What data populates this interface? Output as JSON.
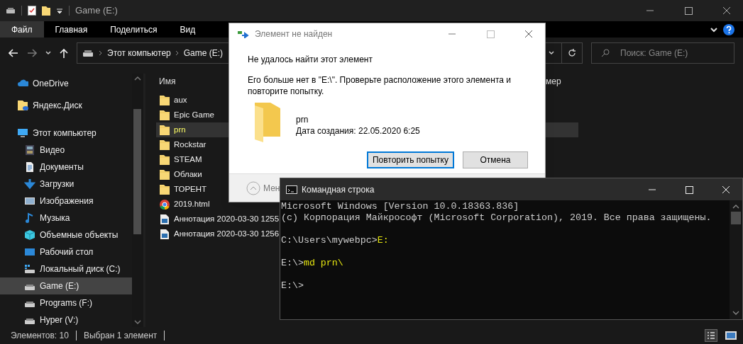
{
  "explorer": {
    "title": "Game (E:)",
    "ribbon_tabs": [
      {
        "label": "Файл",
        "selected": true
      },
      {
        "label": "Главная",
        "selected": false
      },
      {
        "label": "Поделиться",
        "selected": false
      },
      {
        "label": "Вид",
        "selected": false
      }
    ],
    "breadcrumb": [
      "Этот компьютер",
      "Game (E:)"
    ],
    "search": {
      "placeholder": "Поиск: Game (E:)"
    },
    "sidebar": {
      "items": [
        {
          "label": "OneDrive",
          "kind": "cloud",
          "selected": false
        },
        {
          "label": "Яндекс.Диск",
          "kind": "yadisk",
          "selected": false
        },
        {
          "label": "Этот компьютер",
          "kind": "pc",
          "selected": false,
          "children": [
            {
              "label": "Видео",
              "kind": "video",
              "selected": false
            },
            {
              "label": "Документы",
              "kind": "doc",
              "selected": false
            },
            {
              "label": "Загрузки",
              "kind": "download",
              "selected": false
            },
            {
              "label": "Изображения",
              "kind": "image",
              "selected": false
            },
            {
              "label": "Музыка",
              "kind": "music",
              "selected": false
            },
            {
              "label": "Объемные объекты",
              "kind": "cube",
              "selected": false
            },
            {
              "label": "Рабочий стол",
              "kind": "desktop",
              "selected": false
            },
            {
              "label": "Локальный диск (C:)",
              "kind": "sysdrive",
              "selected": false
            },
            {
              "label": "Game (E:)",
              "kind": "drive",
              "selected": true
            },
            {
              "label": "Programs (F:)",
              "kind": "drive",
              "selected": false
            },
            {
              "label": "Hyper (V:)",
              "kind": "drive",
              "selected": false
            }
          ]
        }
      ]
    },
    "columns": [
      "Имя",
      "мер"
    ],
    "files": [
      {
        "name": "aux",
        "kind": "folder",
        "selected": false
      },
      {
        "name": "Epic Game",
        "kind": "folder",
        "selected": false
      },
      {
        "name": "prn",
        "kind": "folder",
        "selected": true
      },
      {
        "name": "Rockstar",
        "kind": "folder",
        "selected": false
      },
      {
        "name": "STEAM",
        "kind": "folder",
        "selected": false
      },
      {
        "name": "Облаки",
        "kind": "folder",
        "selected": false
      },
      {
        "name": "ТОРЕНТ",
        "kind": "folder",
        "selected": false
      },
      {
        "name": "2019.html",
        "kind": "browser",
        "selected": false
      },
      {
        "name": "Аннотация 2020-03-30 1255",
        "kind": "image",
        "selected": false
      },
      {
        "name": "Аннотация 2020-03-30 1256",
        "kind": "image",
        "selected": false
      }
    ],
    "status_bar": [
      "Элементов: 10",
      "Выбран 1 элемент"
    ]
  },
  "dialog": {
    "title": "Элемент не найден",
    "heading": "Не удалось найти этот элемент",
    "message": "Его больше нет в \"E:\\\". Проверьте расположение этого элемента и повторите попытку.",
    "item_name": "prn",
    "item_date": "Дата создания: 22.05.2020 6:25",
    "buttons": [
      "Повторить попытку",
      "Отмена"
    ],
    "details_toggle": "Мен"
  },
  "console": {
    "title": "Командная строка",
    "lines": [
      {
        "kind": "output",
        "text": "Microsoft Windows [Version 10.0.18363.836]"
      },
      {
        "kind": "output",
        "text": "(c) Корпорация Майкрософт (Microsoft Corporation), 2019. Все права защищены."
      },
      {
        "kind": "prompt",
        "prompt": "C:\\Users\\mywebpc>",
        "command": "E:"
      },
      {
        "kind": "prompt",
        "prompt": "E:\\>",
        "command": "md prn\\"
      },
      {
        "kind": "prompt",
        "prompt": "E:\\>"
      }
    ]
  }
}
